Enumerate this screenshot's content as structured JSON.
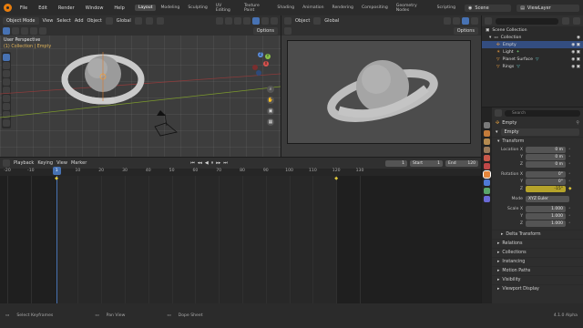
{
  "menu": [
    "File",
    "Edit",
    "Render",
    "Window",
    "Help"
  ],
  "workspaces": [
    "Layout",
    "Modeling",
    "Sculpting",
    "UV Editing",
    "Texture Paint",
    "Shading",
    "Animation",
    "Rendering",
    "Compositing",
    "Geometry Nodes",
    "Scripting"
  ],
  "active_workspace": "Layout",
  "scene_label": "Scene",
  "viewlayer_label": "ViewLayer",
  "viewport": {
    "mode": "Object Mode",
    "menus": [
      "View",
      "Select",
      "Add",
      "Object"
    ],
    "orientation": "Global",
    "options_label": "Options",
    "overlay_title": "User Perspective",
    "overlay_sub": "(1) Collection | Empty",
    "gizmo": {
      "x": "X",
      "y": "Y",
      "z": "Z"
    }
  },
  "camera_view": {
    "object_label": "Object",
    "orientation": "Global",
    "options_label": "Options"
  },
  "timeline": {
    "menus": [
      "Playback",
      "Keying",
      "View",
      "Marker"
    ],
    "current_frame": "1",
    "start_label": "Start",
    "start": "1",
    "end_label": "End",
    "end": "120",
    "ruler": [
      "-20",
      "-10",
      "1",
      "10",
      "20",
      "30",
      "40",
      "50",
      "60",
      "70",
      "80",
      "90",
      "100",
      "110",
      "120",
      "130"
    ],
    "ruler_frames": [
      -20,
      -10,
      1,
      10,
      20,
      30,
      40,
      50,
      60,
      70,
      80,
      90,
      100,
      110,
      120,
      130
    ]
  },
  "outliner": {
    "search_placeholder": "",
    "root": "Scene Collection",
    "collection": "Collection",
    "items": [
      "Empty",
      "Light",
      "Planet Surface",
      "Rings"
    ],
    "selected": "Empty"
  },
  "properties": {
    "search_placeholder": "Search",
    "object_name": "Empty",
    "data_name": "Empty",
    "transform_label": "Transform",
    "location_label": "Location X",
    "location": [
      "0 m",
      "0 m",
      "0 m"
    ],
    "rotation_label": "Rotation X",
    "rotation": [
      "0°",
      "0°",
      "-15°"
    ],
    "axis_y": "Y",
    "axis_z": "Z",
    "mode_label": "Mode",
    "mode_value": "XYZ Euler",
    "scale_label": "Scale X",
    "scale": [
      "1.000",
      "1.000",
      "1.000"
    ],
    "delta_label": "Delta Transform",
    "sections": [
      "Relations",
      "Collections",
      "Instancing",
      "Motion Paths",
      "Visibility",
      "Viewport Display"
    ]
  },
  "status": {
    "select_keyframes": "Select Keyframes",
    "pan_view": "Pan View",
    "dope_sheet": "Dope Sheet",
    "version": "4.1.0 Alpha"
  },
  "colors": {
    "accent_blue": "#4772b3",
    "frame_marker": "#4772b3",
    "keyed_yellow": "#b5a32a",
    "blender_orange": "#e87d0d"
  }
}
